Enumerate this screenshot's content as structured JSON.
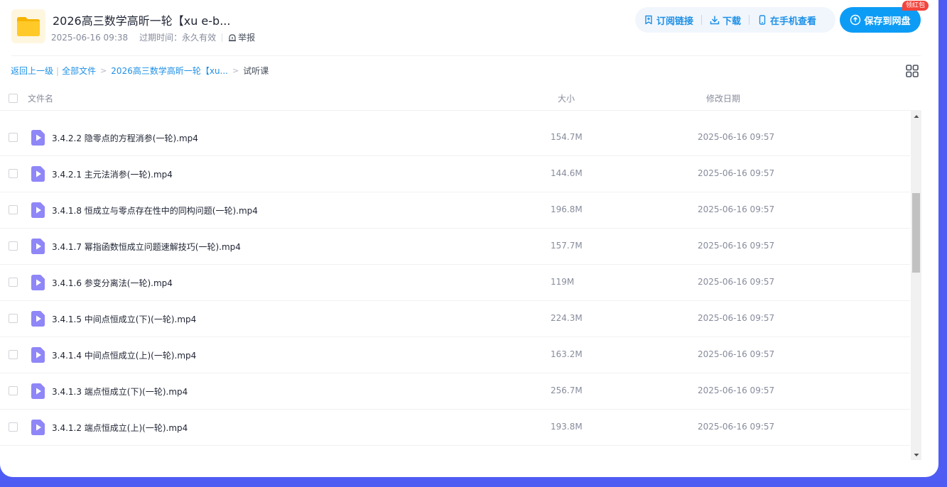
{
  "header": {
    "title": "2026高三数学高昕一轮【xu e-b...",
    "date": "2025-06-16 09:38",
    "expire": "过期时间：永久有效",
    "report_label": "举报",
    "actions": [
      {
        "label": "订阅链接",
        "icon": "bookmark-icon"
      },
      {
        "label": "下载",
        "icon": "download-icon"
      },
      {
        "label": "在手机查看",
        "icon": "phone-icon"
      }
    ],
    "save_label": "保存到网盘",
    "redpack_label": "领红包"
  },
  "breadcrumb": {
    "back": "返回上一级",
    "all_files": "全部文件",
    "folder": "2026高三数学高昕一轮【xu...",
    "current": "试听课",
    "bar": "|",
    "arrow": ">"
  },
  "table": {
    "columns": {
      "name": "文件名",
      "size": "大小",
      "date": "修改日期"
    },
    "rows": [
      {
        "name": "3.4.2.2 隐零点的方程消参(一轮).mp4",
        "size": "154.7M",
        "date": "2025-06-16 09:57"
      },
      {
        "name": "3.4.2.1 主元法消参(一轮).mp4",
        "size": "144.6M",
        "date": "2025-06-16 09:57"
      },
      {
        "name": "3.4.1.8 恒成立与零点存在性中的同构问题(一轮).mp4",
        "size": "196.8M",
        "date": "2025-06-16 09:57"
      },
      {
        "name": "3.4.1.7 幂指函数恒成立问题速解技巧(一轮).mp4",
        "size": "157.7M",
        "date": "2025-06-16 09:57"
      },
      {
        "name": "3.4.1.6 参变分离法(一轮).mp4",
        "size": "119M",
        "date": "2025-06-16 09:57"
      },
      {
        "name": "3.4.1.5 中间点恒成立(下)(一轮).mp4",
        "size": "224.3M",
        "date": "2025-06-16 09:57"
      },
      {
        "name": "3.4.1.4 中间点恒成立(上)(一轮).mp4",
        "size": "163.2M",
        "date": "2025-06-16 09:57"
      },
      {
        "name": "3.4.1.3 端点恒成立(下)(一轮).mp4",
        "size": "256.7M",
        "date": "2025-06-16 09:57"
      },
      {
        "name": "3.4.1.2 端点恒成立(上)(一轮).mp4",
        "size": "193.8M",
        "date": "2025-06-16 09:57"
      }
    ]
  },
  "colors": {
    "accent": "#1e90e6",
    "save_button": "#0d9cf5",
    "page_bg": "#4f5cf3",
    "video_icon": "#8f86f7",
    "redpack": "#f2453d"
  }
}
